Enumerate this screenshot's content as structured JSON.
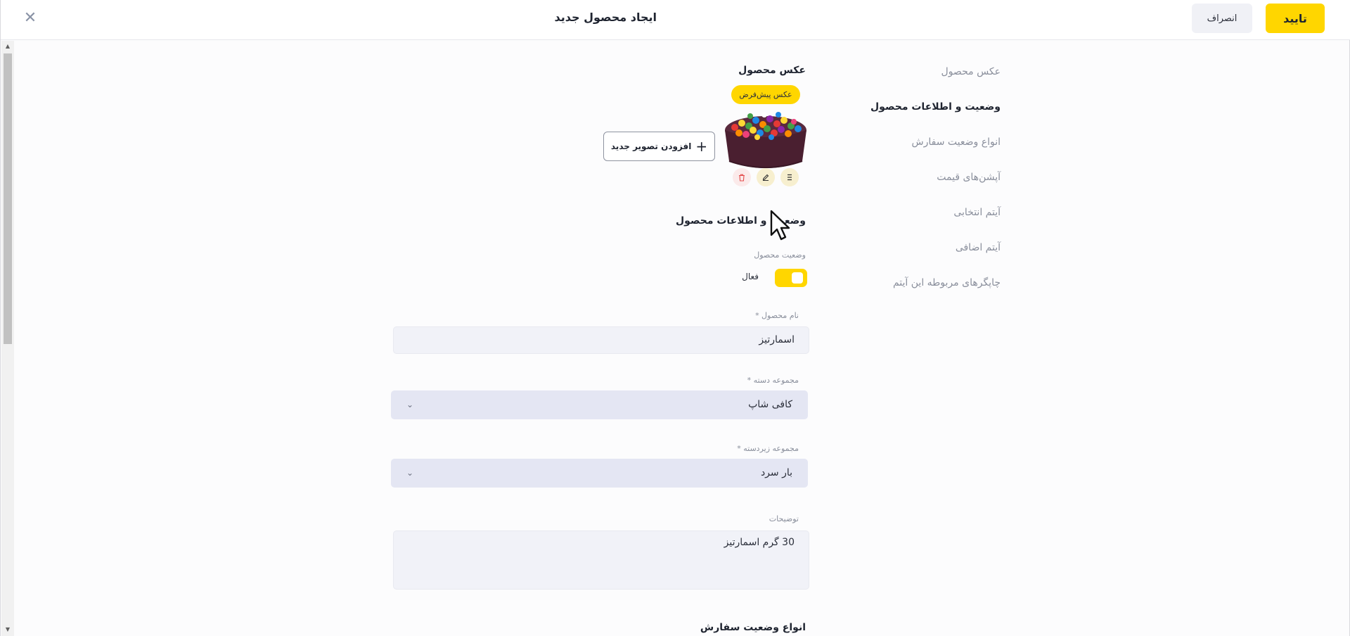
{
  "header": {
    "title": "ایجاد محصول جدید",
    "confirm_label": "تایید",
    "cancel_label": "انصراف",
    "close_icon": "close-icon"
  },
  "nav": {
    "items": [
      {
        "label": "عکس محصول",
        "active": false
      },
      {
        "label": "وضعیت و اطلاعات محصول",
        "active": true
      },
      {
        "label": "انواع وضعیت سفارش",
        "active": false
      },
      {
        "label": "آپشن‌های قیمت",
        "active": false
      },
      {
        "label": "آیتم انتخابی",
        "active": false
      },
      {
        "label": "آیتم اضافی",
        "active": false
      },
      {
        "label": "چاپگرهای مربوطه این آیتم",
        "active": false
      }
    ]
  },
  "image_section": {
    "title": "عکس محصول",
    "default_badge": "عکس پیش‌فرض",
    "add_button": "افزودن تصویر جدید",
    "actions": [
      "trash-icon",
      "edit-icon",
      "drag-icon"
    ]
  },
  "info_section": {
    "title": "وضعیت و اطلاعات محصول",
    "status_label": "وضعیت محصول",
    "status_value": "فعال",
    "status_on": true,
    "name_label": "نام محصول *",
    "name_value": "اسمارتیز",
    "category_label": "مجموعه دسته *",
    "category_value": "کافی شاپ",
    "subcategory_label": "مجموعه زیردسته *",
    "subcategory_value": "بار سرد",
    "description_label": "توضیحات",
    "description_value": "30 گرم اسمارتیز"
  },
  "order_section": {
    "title": "انواع وضعیت سفارش"
  },
  "colors": {
    "accent": "#ffd600",
    "input_bg": "#f1f2f8",
    "select_bg": "#e4e6f3"
  }
}
